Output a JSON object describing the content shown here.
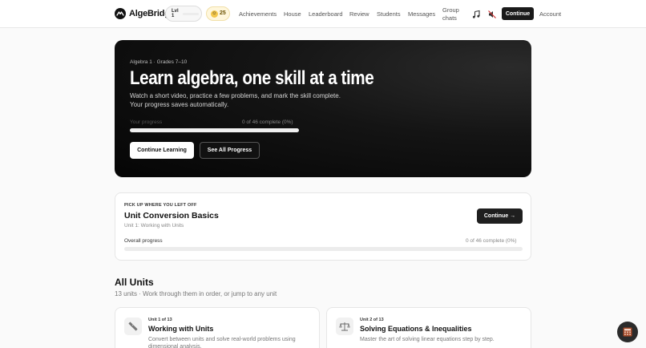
{
  "nav": {
    "brand": "AlgeBridge",
    "level_label": "Lvl 1",
    "coins": "25",
    "links": {
      "achievements": "Achievements",
      "house": "House",
      "leaderboard": "Leaderboard",
      "review": "Review",
      "students": "Students",
      "messages": "Messages",
      "group_chats": "Group chats"
    },
    "continue_label": "Continue",
    "account_label": "Account",
    "icons": [
      "logo-icon",
      "coin-icon",
      "music-note-icon",
      "sound-off-icon"
    ]
  },
  "hero": {
    "eyebrow": "Algebra 1 · Grades 7–10",
    "title": "Learn algebra, one skill at a time",
    "desc_line1": "Watch a short video, practice a few problems, and mark the skill complete.",
    "desc_line2": "Your progress saves automatically.",
    "progress_label": "Your progress",
    "progress_count": "0 of 46 complete (0%)",
    "progress_fraction": 0,
    "primary_label": "Continue Learning",
    "secondary_label": "See All Progress"
  },
  "resume": {
    "eyebrow": "PICK UP WHERE YOU LEFT OFF",
    "title": "Unit Conversion Basics",
    "subtitle": "Unit 1: Working with Units",
    "button_label": "Continue →",
    "progress_label": "Overall progress",
    "progress_count": "0 of 46 complete (0%)",
    "progress_fraction": 0
  },
  "units": {
    "heading": "All Units",
    "subheading": "13 units · Work through them in order, or jump to any unit",
    "cards": [
      {
        "number": "Unit 1 of 13",
        "title": "Working with Units",
        "description": "Convert between units and solve real-world problems using dimensional analysis.",
        "icon": "ruler-icon"
      },
      {
        "number": "Unit 2 of 13",
        "title": "Solving Equations & Inequalities",
        "description": "Master the art of solving linear equations step by step.",
        "icon": "balance-scale-icon"
      }
    ]
  },
  "fab_icon": "calculator-icon"
}
